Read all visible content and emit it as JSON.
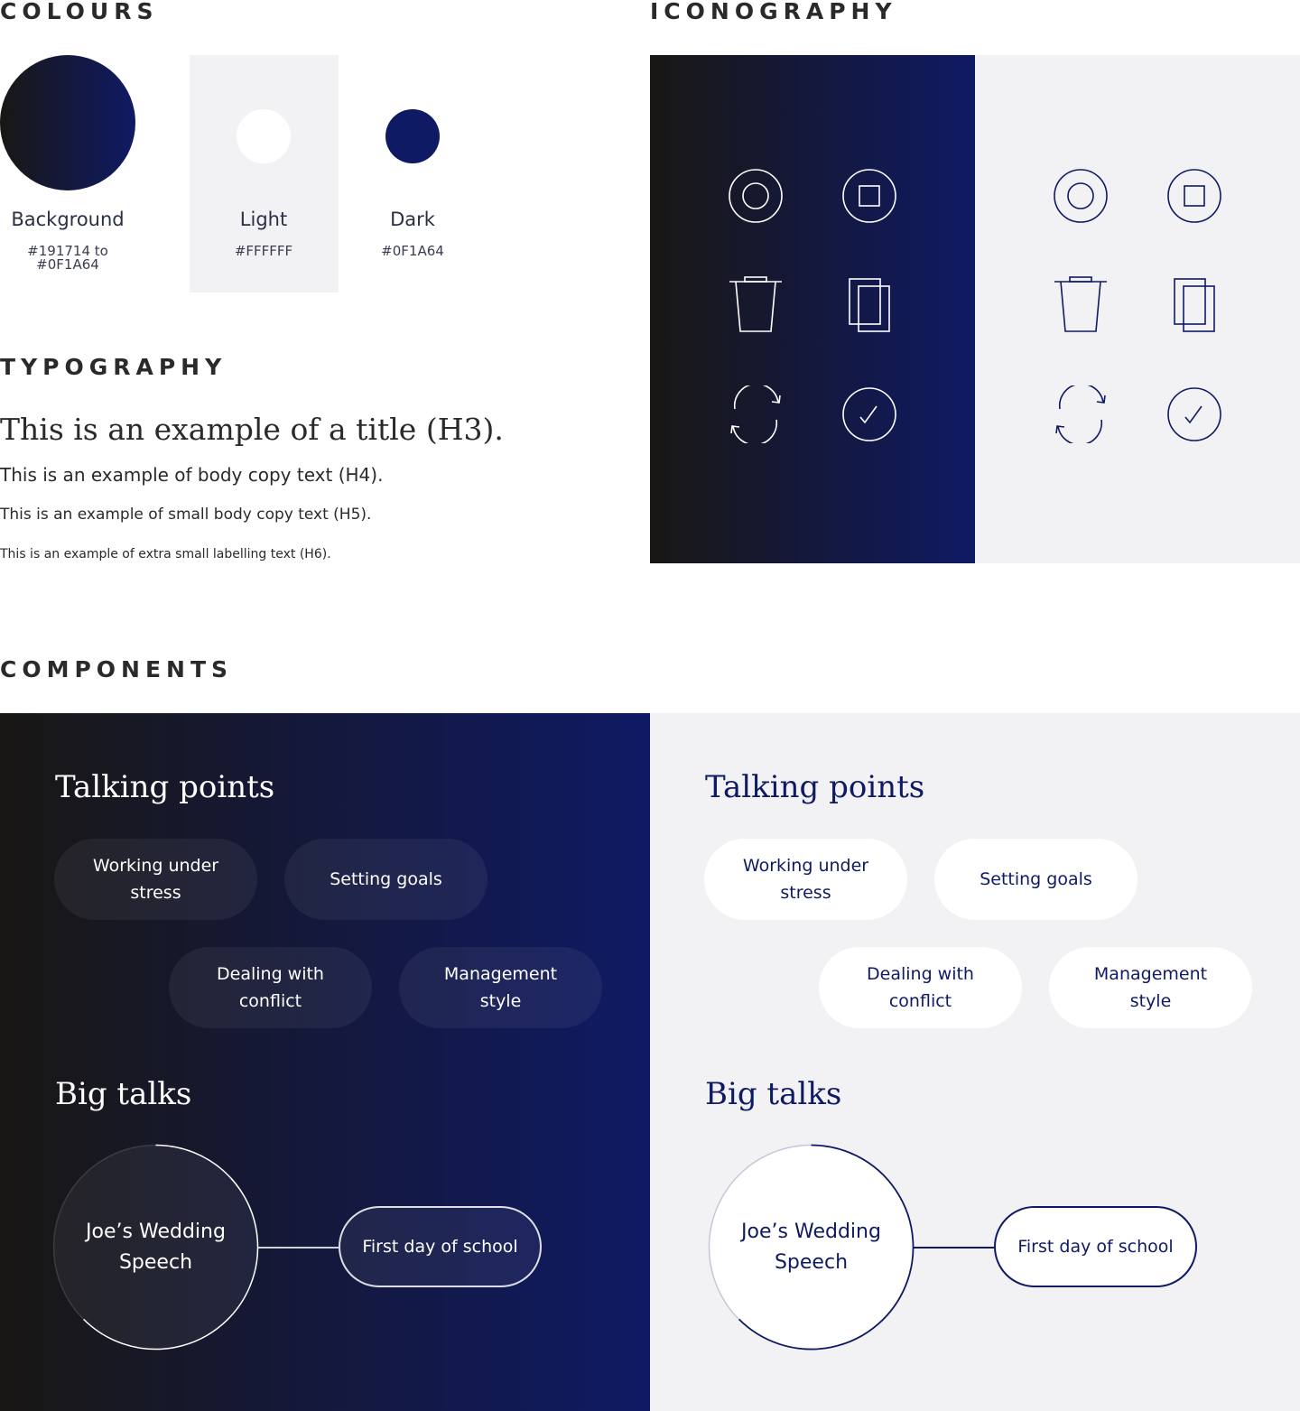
{
  "headings": {
    "colours": "COLOURS",
    "iconography": "ICONOGRAPHY",
    "typography": "TYPOGRAPHY",
    "components": "COMPONENTS"
  },
  "colours": {
    "background": {
      "name": "Background",
      "hex": "#191714 to #0F1A64",
      "from": "#191714",
      "to": "#0F1A64"
    },
    "light": {
      "name": "Light",
      "hex": "#FFFFFF"
    },
    "dark": {
      "name": "Dark",
      "hex": "#0F1A64"
    }
  },
  "typography": {
    "h3": "This is an example of a title (H3).",
    "h4": "This is an example of body copy text (H4).",
    "h5": "This is an example of small body copy text (H5).",
    "h6": "This is an example of extra small labelling text (H6)."
  },
  "iconography": {
    "icons": [
      "record-icon",
      "stop-icon",
      "trash-icon",
      "copy-icon",
      "refresh-icon",
      "check-icon"
    ]
  },
  "components": {
    "dark": {
      "talking_points_title": "Talking points",
      "talking_points": [
        "Working under stress",
        "Setting goals",
        "Dealing with conflict",
        "Management style"
      ],
      "big_talks_title": "Big talks",
      "main_talk": "Joe’s Wedding Speech",
      "linked_talk": "First day of school"
    },
    "light": {
      "talking_points_title": "Talking points",
      "talking_points": [
        "Working under stress",
        "Setting goals",
        "Dealing with conflict",
        "Management style"
      ],
      "big_talks_title": "Big talks",
      "main_talk": "Joe’s Wedding Speech",
      "linked_talk": "First day of school"
    }
  }
}
